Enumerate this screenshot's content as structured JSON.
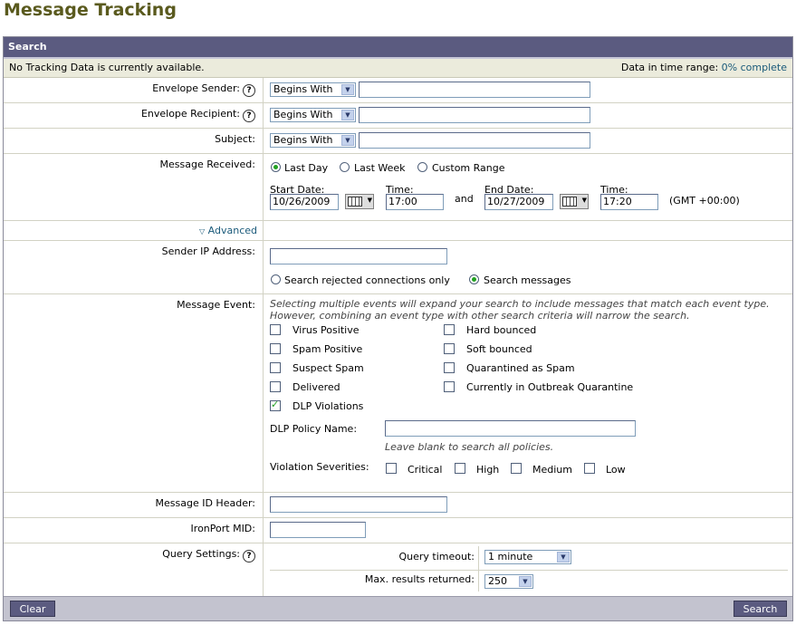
{
  "page_title": "Message Tracking",
  "panel": {
    "title": "Search"
  },
  "status": {
    "left": "No Tracking Data is currently available.",
    "right_label": "Data in time range:",
    "right_link": "0% complete"
  },
  "envelope_sender": {
    "label": "Envelope Sender:",
    "operator": "Begins With",
    "value": ""
  },
  "envelope_recipient": {
    "label": "Envelope Recipient:",
    "operator": "Begins With",
    "value": ""
  },
  "subject": {
    "label": "Subject:",
    "operator": "Begins With",
    "value": ""
  },
  "message_received": {
    "label": "Message Received:",
    "options": [
      "Last Day",
      "Last Week",
      "Custom Range"
    ],
    "selected": "Last Day",
    "start_date_label": "Start Date:",
    "start_date": "10/26/2009",
    "start_time_label": "Time:",
    "start_time": "17:00",
    "and_label": "and",
    "end_date_label": "End Date:",
    "end_date": "10/27/2009",
    "end_time_label": "Time:",
    "end_time": "17:20",
    "timezone": "(GMT +00:00)"
  },
  "advanced": {
    "label": "Advanced"
  },
  "sender_ip": {
    "label": "Sender IP Address:",
    "value": "",
    "options": [
      "Search rejected connections only",
      "Search messages"
    ],
    "selected": "Search messages"
  },
  "message_event": {
    "label": "Message Event:",
    "hint_line1": "Selecting multiple events will expand your search to include messages that match each event type.",
    "hint_line2": "However, combining an event type with other search criteria will narrow the search.",
    "left_events": [
      {
        "label": "Virus Positive",
        "checked": false
      },
      {
        "label": "Spam Positive",
        "checked": false
      },
      {
        "label": "Suspect Spam",
        "checked": false
      },
      {
        "label": "Delivered",
        "checked": false
      },
      {
        "label": "DLP Violations",
        "checked": true
      }
    ],
    "right_events": [
      {
        "label": "Hard bounced",
        "checked": false
      },
      {
        "label": "Soft bounced",
        "checked": false
      },
      {
        "label": "Quarantined as Spam",
        "checked": false
      },
      {
        "label": "Currently in Outbreak Quarantine",
        "checked": false
      }
    ],
    "dlp_policy_label": "DLP Policy Name:",
    "dlp_policy_value": "",
    "dlp_policy_hint": "Leave blank to search all policies.",
    "severities_label": "Violation Severities:",
    "severities": [
      {
        "label": "Critical",
        "checked": false
      },
      {
        "label": "High",
        "checked": false
      },
      {
        "label": "Medium",
        "checked": false
      },
      {
        "label": "Low",
        "checked": false
      }
    ]
  },
  "message_id_header": {
    "label": "Message ID Header:",
    "value": ""
  },
  "ironport_mid": {
    "label": "IronPort MID:",
    "value": ""
  },
  "query_settings": {
    "label": "Query Settings:",
    "timeout_label": "Query timeout:",
    "timeout_value": "1 minute",
    "max_results_label": "Max. results returned:",
    "max_results_value": "250"
  },
  "buttons": {
    "clear": "Clear",
    "search": "Search"
  }
}
